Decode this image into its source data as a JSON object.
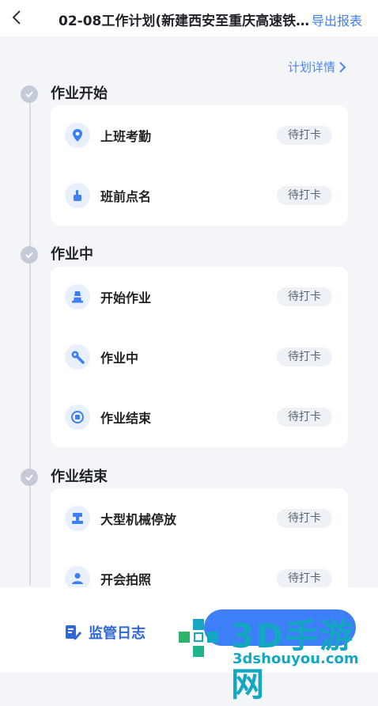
{
  "header": {
    "title": "02-08工作计划(新建西安至重庆高速铁路...",
    "export_label": "导出报表"
  },
  "detail_link": "计划详情",
  "stages": [
    {
      "title": "作业开始",
      "items": [
        {
          "label": "上班考勤",
          "status": "待打卡"
        },
        {
          "label": "班前点名",
          "status": "待打卡"
        }
      ]
    },
    {
      "title": "作业中",
      "items": [
        {
          "label": "开始作业",
          "status": "待打卡"
        },
        {
          "label": "作业中",
          "status": "待打卡"
        },
        {
          "label": "作业结束",
          "status": "待打卡"
        }
      ]
    },
    {
      "title": "作业结束",
      "items": [
        {
          "label": "大型机械停放",
          "status": "待打卡"
        },
        {
          "label": "开会拍照",
          "status": "待打卡"
        }
      ]
    }
  ],
  "bottom": {
    "log_label": "监管日志"
  },
  "watermark": {
    "brand": "3D手游网",
    "site": "3dshouyou.com"
  },
  "colors": {
    "accent": "#3d7ff6",
    "badge_bg": "#eef2f7",
    "icon_bg": "#e8f0fd"
  }
}
